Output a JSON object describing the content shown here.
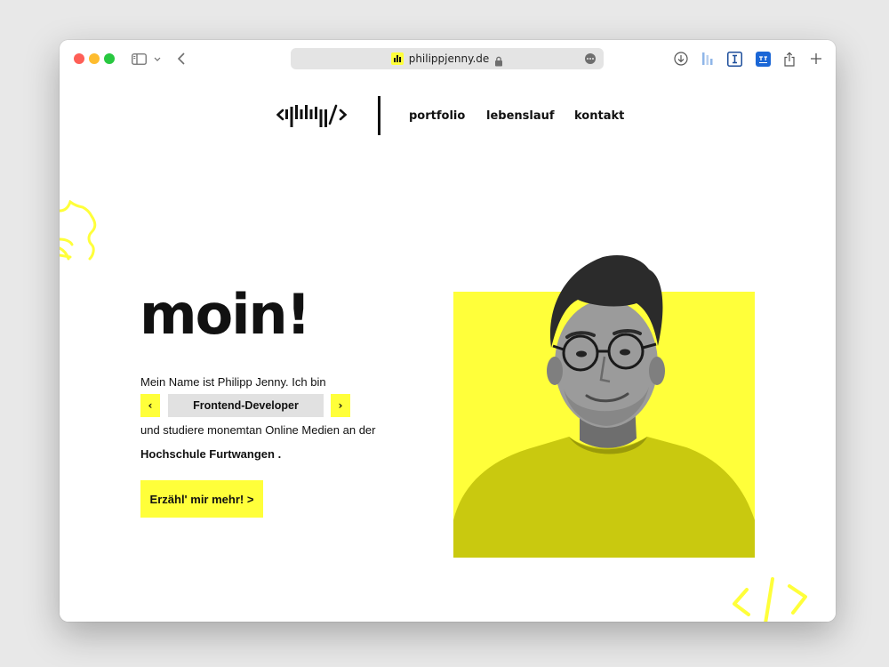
{
  "browser": {
    "url": "philippjenny.de",
    "icons": [
      "sidebar-icon",
      "chevron-down-icon",
      "back-icon",
      "lock-icon",
      "more-icon",
      "download-icon",
      "extension-icon",
      "extension-icon",
      "extension-icon",
      "share-icon",
      "plus-icon"
    ]
  },
  "nav": {
    "items": [
      "portfolio",
      "lebenslauf",
      "kontakt"
    ]
  },
  "hero": {
    "heading": "moin!",
    "intro": "Mein Name ist Philipp Jenny. Ich bin",
    "role": "Frontend-Developer",
    "prev": "‹",
    "next": "›",
    "study": "und studiere monemtan Online Medien an der",
    "school": "Hochschule Furtwangen .",
    "cta": "Erzähl' mir mehr! >"
  },
  "colors": {
    "accent": "#ffff3a",
    "text": "#111111",
    "chip": "#e1e1e1"
  }
}
